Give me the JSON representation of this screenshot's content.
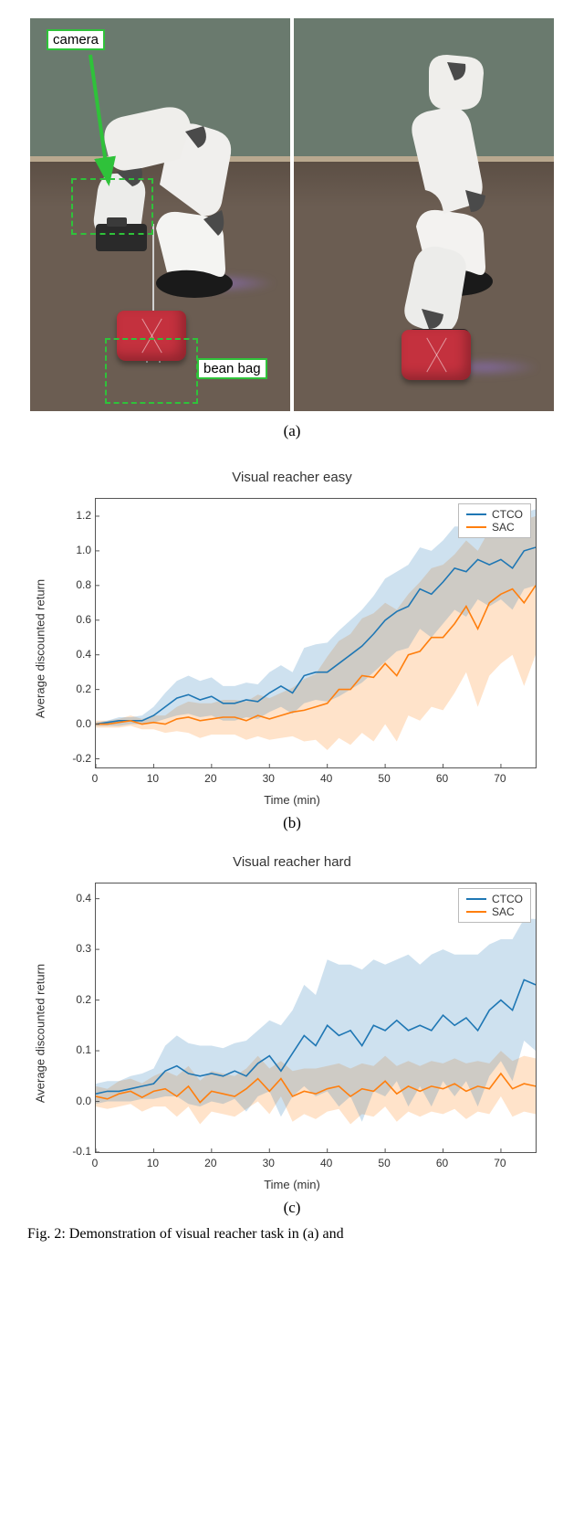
{
  "photo_labels": {
    "camera": "camera",
    "beanbag": "bean bag"
  },
  "subfigure_labels": {
    "a": "(a)",
    "b": "(b)",
    "c": "(c)"
  },
  "chart_easy": {
    "title": "Visual reacher easy",
    "xlabel": "Time (min)",
    "ylabel": "Average discounted return",
    "legend": [
      "CTCO",
      "SAC"
    ]
  },
  "chart_hard": {
    "title": "Visual reacher hard",
    "xlabel": "Time (min)",
    "ylabel": "Average discounted return",
    "legend": [
      "CTCO",
      "SAC"
    ]
  },
  "caption": "Fig.  2:  Demonstration  of  visual  reacher  task  in  (a)  and",
  "chart_data": [
    {
      "id": "easy",
      "type": "line",
      "title": "Visual reacher easy",
      "xlabel": "Time (min)",
      "ylabel": "Average discounted return",
      "xlim": [
        0,
        76
      ],
      "ylim": [
        -0.25,
        1.3
      ],
      "xticks": [
        0,
        10,
        20,
        30,
        40,
        50,
        60,
        70
      ],
      "yticks": [
        -0.2,
        0.0,
        0.2,
        0.4,
        0.6,
        0.8,
        1.0,
        1.2
      ],
      "x": [
        0,
        2,
        4,
        6,
        8,
        10,
        12,
        14,
        16,
        18,
        20,
        22,
        24,
        26,
        28,
        30,
        32,
        34,
        36,
        38,
        40,
        42,
        44,
        46,
        48,
        50,
        52,
        54,
        56,
        58,
        60,
        62,
        64,
        66,
        68,
        70,
        72,
        74,
        76
      ],
      "series": [
        {
          "name": "CTCO",
          "color": "#1f77b4",
          "values": [
            0.0,
            0.01,
            0.02,
            0.02,
            0.02,
            0.05,
            0.1,
            0.15,
            0.17,
            0.14,
            0.16,
            0.12,
            0.12,
            0.14,
            0.13,
            0.18,
            0.22,
            0.18,
            0.28,
            0.3,
            0.3,
            0.35,
            0.4,
            0.45,
            0.52,
            0.6,
            0.65,
            0.68,
            0.78,
            0.75,
            0.82,
            0.9,
            0.88,
            0.95,
            0.92,
            0.95,
            0.9,
            1.0,
            1.02
          ],
          "lo": [
            -0.01,
            -0.01,
            -0.01,
            0.0,
            0.0,
            0.01,
            0.03,
            0.05,
            0.06,
            0.04,
            0.05,
            0.02,
            0.02,
            0.04,
            0.03,
            0.07,
            0.1,
            0.06,
            0.12,
            0.14,
            0.13,
            0.16,
            0.2,
            0.24,
            0.3,
            0.36,
            0.42,
            0.44,
            0.55,
            0.5,
            0.58,
            0.66,
            0.62,
            0.72,
            0.68,
            0.72,
            0.66,
            0.78,
            0.8
          ],
          "hi": [
            0.01,
            0.02,
            0.04,
            0.04,
            0.05,
            0.1,
            0.18,
            0.25,
            0.28,
            0.25,
            0.27,
            0.22,
            0.22,
            0.24,
            0.23,
            0.3,
            0.34,
            0.3,
            0.44,
            0.46,
            0.47,
            0.54,
            0.6,
            0.66,
            0.74,
            0.84,
            0.88,
            0.92,
            1.02,
            1.0,
            1.06,
            1.14,
            1.14,
            1.18,
            1.16,
            1.18,
            1.14,
            1.22,
            1.24
          ]
        },
        {
          "name": "SAC",
          "color": "#ff7f0e",
          "values": [
            0.0,
            0.0,
            0.01,
            0.02,
            0.0,
            0.01,
            0.0,
            0.03,
            0.04,
            0.02,
            0.03,
            0.04,
            0.04,
            0.02,
            0.05,
            0.03,
            0.05,
            0.07,
            0.08,
            0.1,
            0.12,
            0.2,
            0.2,
            0.28,
            0.27,
            0.35,
            0.28,
            0.4,
            0.42,
            0.5,
            0.5,
            0.58,
            0.68,
            0.55,
            0.7,
            0.75,
            0.78,
            0.7,
            0.8
          ],
          "lo": [
            -0.02,
            -0.02,
            -0.02,
            -0.01,
            -0.03,
            -0.03,
            -0.05,
            -0.04,
            -0.05,
            -0.08,
            -0.06,
            -0.06,
            -0.06,
            -0.09,
            -0.07,
            -0.09,
            -0.08,
            -0.07,
            -0.1,
            -0.09,
            -0.15,
            -0.08,
            -0.12,
            -0.05,
            -0.1,
            0.0,
            -0.1,
            0.05,
            0.02,
            0.1,
            0.08,
            0.18,
            0.3,
            0.1,
            0.28,
            0.35,
            0.4,
            0.22,
            0.4
          ],
          "hi": [
            0.02,
            0.02,
            0.03,
            0.05,
            0.03,
            0.05,
            0.05,
            0.1,
            0.13,
            0.12,
            0.12,
            0.14,
            0.14,
            0.13,
            0.17,
            0.15,
            0.18,
            0.21,
            0.26,
            0.29,
            0.39,
            0.48,
            0.52,
            0.61,
            0.64,
            0.7,
            0.66,
            0.75,
            0.82,
            0.9,
            0.92,
            0.98,
            1.06,
            1.0,
            1.12,
            1.15,
            1.16,
            1.18,
            1.2
          ]
        }
      ]
    },
    {
      "id": "hard",
      "type": "line",
      "title": "Visual reacher hard",
      "xlabel": "Time (min)",
      "ylabel": "Average discounted return",
      "xlim": [
        0,
        76
      ],
      "ylim": [
        -0.1,
        0.43
      ],
      "xticks": [
        0,
        10,
        20,
        30,
        40,
        50,
        60,
        70
      ],
      "yticks": [
        -0.1,
        0.0,
        0.1,
        0.2,
        0.3,
        0.4
      ],
      "x": [
        0,
        2,
        4,
        6,
        8,
        10,
        12,
        14,
        16,
        18,
        20,
        22,
        24,
        26,
        28,
        30,
        32,
        34,
        36,
        38,
        40,
        42,
        44,
        46,
        48,
        50,
        52,
        54,
        56,
        58,
        60,
        62,
        64,
        66,
        68,
        70,
        72,
        74,
        76
      ],
      "series": [
        {
          "name": "CTCO",
          "color": "#1f77b4",
          "values": [
            0.015,
            0.02,
            0.02,
            0.025,
            0.03,
            0.035,
            0.06,
            0.07,
            0.055,
            0.05,
            0.055,
            0.05,
            0.06,
            0.05,
            0.075,
            0.09,
            0.06,
            0.095,
            0.13,
            0.11,
            0.15,
            0.13,
            0.14,
            0.11,
            0.15,
            0.14,
            0.16,
            0.14,
            0.15,
            0.14,
            0.17,
            0.15,
            0.165,
            0.14,
            0.18,
            0.2,
            0.18,
            0.24,
            0.23
          ],
          "lo": [
            -0.005,
            0.0,
            0.0,
            0.0,
            0.005,
            0.005,
            0.01,
            0.01,
            -0.005,
            -0.01,
            0.0,
            -0.005,
            0.005,
            -0.02,
            0.01,
            0.02,
            -0.03,
            0.01,
            0.03,
            0.01,
            0.02,
            -0.01,
            0.01,
            -0.04,
            0.02,
            0.01,
            0.04,
            -0.01,
            0.03,
            -0.01,
            0.04,
            0.01,
            0.04,
            -0.01,
            0.05,
            0.08,
            0.04,
            0.12,
            0.1
          ],
          "hi": [
            0.035,
            0.04,
            0.04,
            0.05,
            0.055,
            0.065,
            0.11,
            0.13,
            0.115,
            0.11,
            0.11,
            0.105,
            0.115,
            0.12,
            0.14,
            0.16,
            0.15,
            0.18,
            0.23,
            0.21,
            0.28,
            0.27,
            0.27,
            0.26,
            0.28,
            0.27,
            0.28,
            0.29,
            0.27,
            0.29,
            0.3,
            0.29,
            0.29,
            0.29,
            0.31,
            0.32,
            0.32,
            0.36,
            0.36
          ]
        },
        {
          "name": "SAC",
          "color": "#ff7f0e",
          "values": [
            0.01,
            0.005,
            0.015,
            0.02,
            0.008,
            0.02,
            0.025,
            0.01,
            0.03,
            -0.002,
            0.02,
            0.015,
            0.01,
            0.025,
            0.045,
            0.02,
            0.045,
            0.01,
            0.02,
            0.015,
            0.025,
            0.03,
            0.01,
            0.025,
            0.02,
            0.04,
            0.015,
            0.03,
            0.02,
            0.03,
            0.025,
            0.035,
            0.02,
            0.03,
            0.025,
            0.055,
            0.025,
            0.035,
            0.03
          ],
          "lo": [
            -0.01,
            -0.015,
            -0.01,
            -0.005,
            -0.02,
            -0.01,
            -0.01,
            -0.03,
            -0.01,
            -0.045,
            -0.02,
            -0.025,
            -0.03,
            -0.015,
            0.0,
            -0.025,
            0.01,
            -0.04,
            -0.025,
            -0.035,
            -0.02,
            -0.015,
            -0.045,
            -0.025,
            -0.03,
            -0.01,
            -0.04,
            -0.02,
            -0.03,
            -0.02,
            -0.025,
            -0.015,
            -0.035,
            -0.02,
            -0.025,
            0.01,
            -0.03,
            -0.02,
            -0.025
          ],
          "hi": [
            0.03,
            0.025,
            0.04,
            0.045,
            0.036,
            0.05,
            0.06,
            0.05,
            0.07,
            0.041,
            0.06,
            0.055,
            0.05,
            0.065,
            0.09,
            0.065,
            0.08,
            0.06,
            0.065,
            0.065,
            0.07,
            0.075,
            0.065,
            0.075,
            0.07,
            0.09,
            0.07,
            0.08,
            0.07,
            0.08,
            0.075,
            0.085,
            0.075,
            0.08,
            0.075,
            0.1,
            0.08,
            0.09,
            0.085
          ]
        }
      ]
    }
  ]
}
